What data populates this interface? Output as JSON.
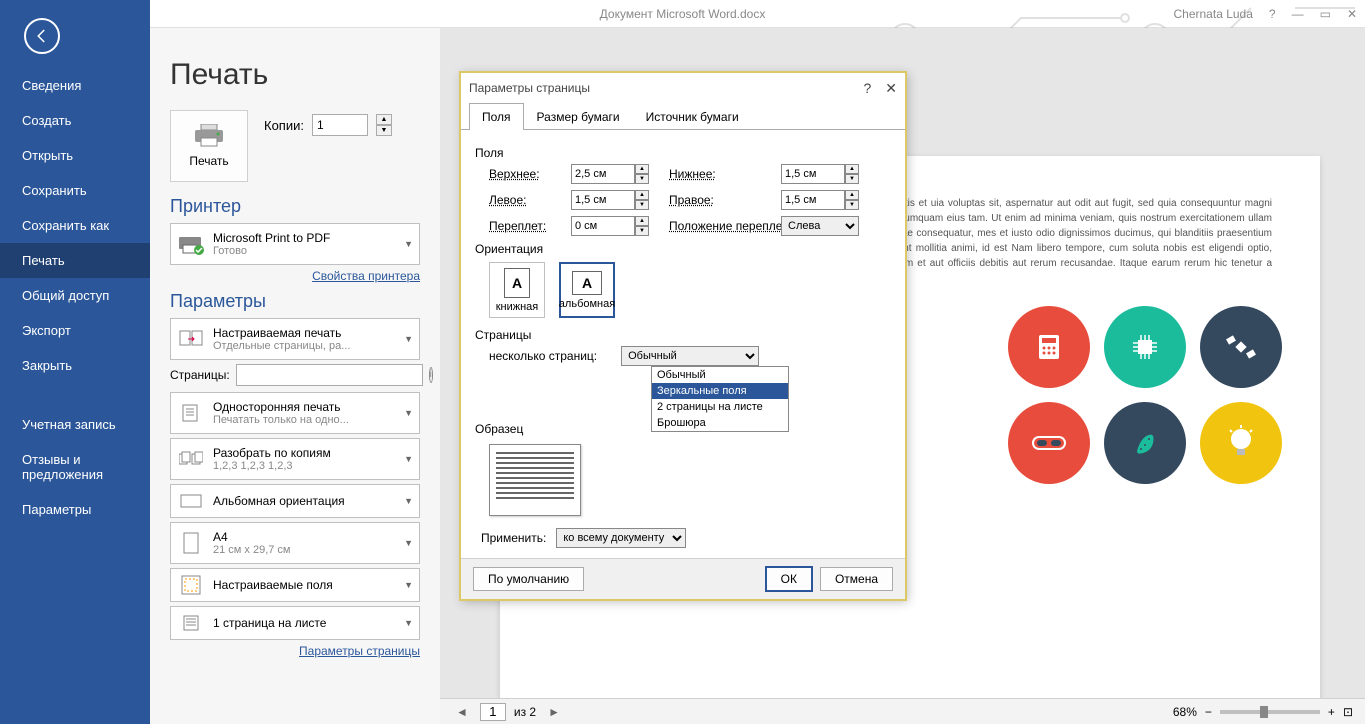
{
  "titlebar": {
    "document": "Документ Microsoft Word.docx",
    "user": "Chernata Luda",
    "help": "?",
    "minimize": "—",
    "close": "✕"
  },
  "sidebar": {
    "items": [
      "Сведения",
      "Создать",
      "Открыть",
      "Сохранить",
      "Сохранить как",
      "Печать",
      "Общий доступ",
      "Экспорт",
      "Закрыть"
    ],
    "bottom": [
      "Учетная запись",
      "Отзывы и предложения",
      "Параметры"
    ]
  },
  "panel": {
    "title": "Печать",
    "print_label": "Печать",
    "copies_label": "Копии:",
    "copies_value": "1",
    "printer_title": "Принтер",
    "printer_name": "Microsoft Print to PDF",
    "printer_status": "Готово",
    "printer_props": "Свойства принтера",
    "settings_title": "Параметры",
    "custom_print": {
      "l1": "Настраиваемая печать",
      "l2": "Отдельные страницы, ра..."
    },
    "pages_label": "Страницы:",
    "onesided": {
      "l1": "Односторонняя печать",
      "l2": "Печатать только на одно..."
    },
    "collate": {
      "l1": "Разобрать по копиям",
      "l2": "1,2,3   1,2,3   1,2,3"
    },
    "orientation": {
      "l1": "Альбомная ориентация",
      "l2": ""
    },
    "paper": {
      "l1": "A4",
      "l2": "21 см x 29,7 см"
    },
    "margins": {
      "l1": "Настраиваемые поля",
      "l2": ""
    },
    "pages_per": {
      "l1": "1 страница на листе",
      "l2": ""
    },
    "page_setup_link": "Параметры страницы"
  },
  "dialog": {
    "title": "Параметры страницы",
    "tabs": [
      "Поля",
      "Размер бумаги",
      "Источник бумаги"
    ],
    "fields_label": "Поля",
    "top": {
      "label": "Верхнее:",
      "value": "2,5 см"
    },
    "bottom": {
      "label": "Нижнее:",
      "value": "1,5 см"
    },
    "left": {
      "label": "Левое:",
      "value": "1,5 см"
    },
    "right": {
      "label": "Правое:",
      "value": "1,5 см"
    },
    "gutter": {
      "label": "Переплет:",
      "value": "0 см"
    },
    "gutter_pos": {
      "label": "Положение переплета:",
      "value": "Слева"
    },
    "orientation_label": "Ориентация",
    "portrait": "книжная",
    "landscape": "альбомная",
    "pages_label": "Страницы",
    "multi_pages_label": "несколько страниц:",
    "multi_pages_value": "Обычный",
    "multi_options": [
      "Обычный",
      "Зеркальные поля",
      "2 страницы на листе",
      "Брошюра"
    ],
    "sample_label": "Образец",
    "apply_label": "Применить:",
    "apply_value": "ко всему документу",
    "default_btn": "По умолчанию",
    "ok_btn": "ОК",
    "cancel_btn": "Отмена"
  },
  "preview": {
    "text": "mque laudantium, totam rem aperiam eaque ipsa, quae ab illo inventore veritatis et uia voluptas sit, aspernatur aut odit aut fugit, sed quia consequuntur magni dolores a ipsum, quia dolor sit, amet, consectetur, adipisci velit, sed quia non numquam eius tam. Ut enim ad minima veniam, quis nostrum exercitationem ullam corporis m iure reprehenderit, qui in ea voluptate velit esse, quam nihil molestiae consequatur, mes et iusto odio dignissimos ducimus, qui blanditiis praesentium voluptatum deleniti e non provident, similique sunt in culpa, qui officia deserunt mollitia animi, id est Nam libero tempore, cum soluta nobis est eligendi optio, cumque nihil impedit, quo nnis dolor repellendus. Temporibus autem quibusdam et aut officiis debitis aut rerum recusandae. Itaque earum rerum hic tenetur a sapiente delectus, ut aut reiciendis",
    "footer": {
      "page": "1",
      "of_label": "из 2",
      "zoom": "68%"
    }
  }
}
